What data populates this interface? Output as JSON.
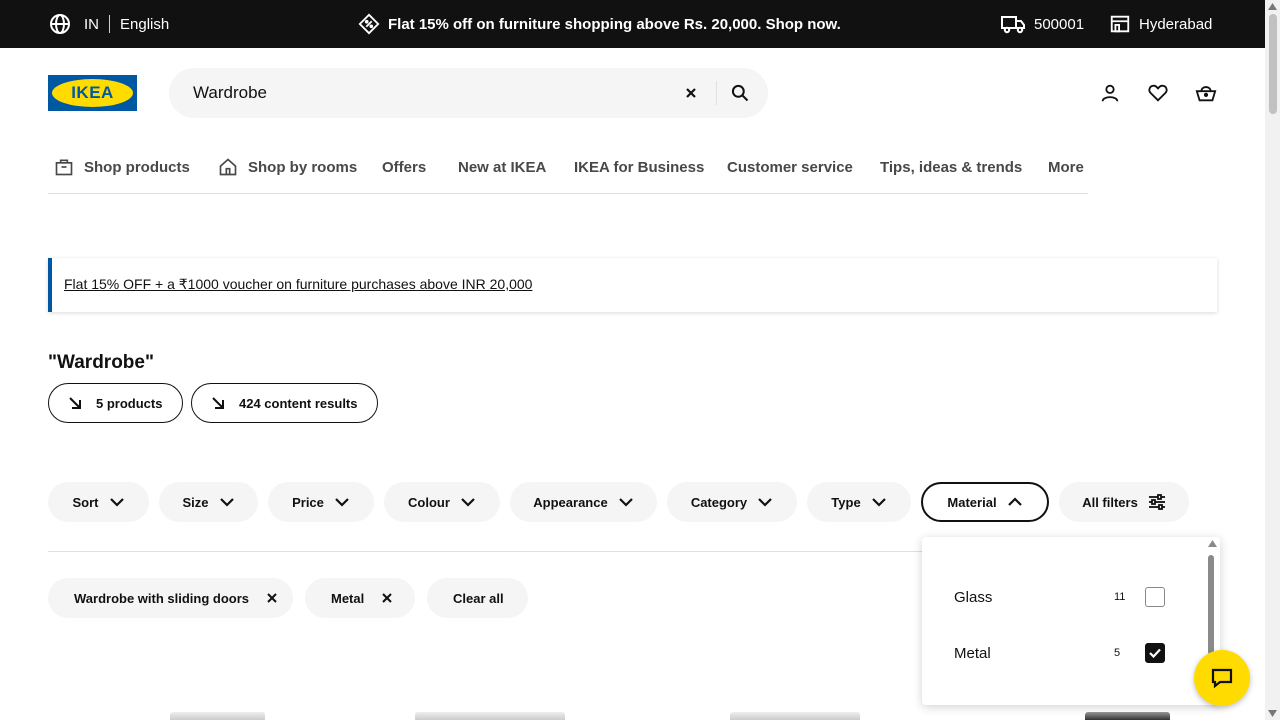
{
  "topbar": {
    "country": "IN",
    "language": "English",
    "promo": "Flat 15% off on furniture shopping above Rs. 20,000. Shop now.",
    "pincode": "500001",
    "store": "Hyderabad"
  },
  "header": {
    "logo_text": "IKEA",
    "search_value": "Wardrobe"
  },
  "nav": [
    {
      "label": "Shop products",
      "icon": "bag-icon"
    },
    {
      "label": "Shop by rooms",
      "icon": "house-icon"
    },
    {
      "label": "Offers"
    },
    {
      "label": "New at IKEA"
    },
    {
      "label": "IKEA for Business"
    },
    {
      "label": "Customer service"
    },
    {
      "label": "Tips, ideas & trends"
    },
    {
      "label": "More"
    }
  ],
  "banner": {
    "text": "Flat 15% OFF + a ₹1000 voucher on furniture purchases above INR 20,000"
  },
  "results": {
    "title": "\"Wardrobe\"",
    "products_label": "5 products",
    "content_label": "424 content results"
  },
  "filters": [
    "Sort",
    "Size",
    "Price",
    "Colour",
    "Appearance",
    "Category",
    "Type",
    "Material",
    "All filters"
  ],
  "active_filters": [
    "Wardrobe with sliding doors",
    "Metal"
  ],
  "clear_all": "Clear all",
  "material_dropdown": {
    "options": [
      {
        "label": "Glass",
        "count": "11",
        "checked": false
      },
      {
        "label": "Metal",
        "count": "5",
        "checked": true
      }
    ]
  },
  "colors": {
    "brand_blue": "#0058a3",
    "brand_yellow": "#ffdb00",
    "topbar": "#111111"
  }
}
